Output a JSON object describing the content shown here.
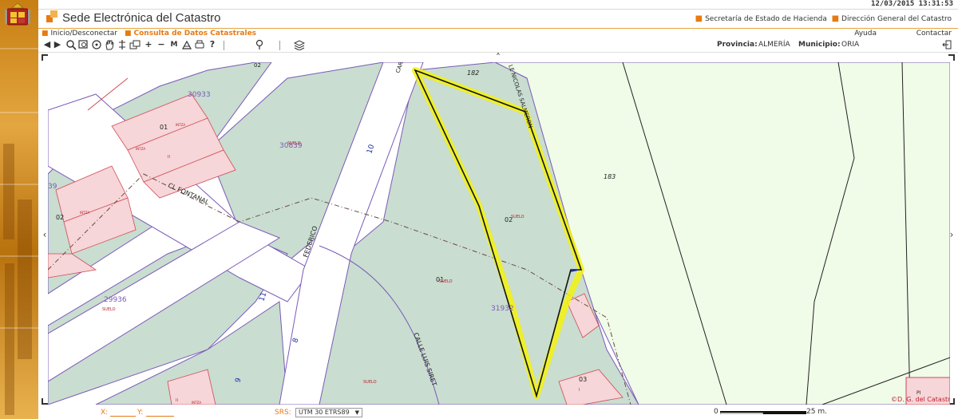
{
  "datetime": "12/03/2015 13:31:53",
  "site_title": "Sede Electrónica del Catastro",
  "header_links": [
    "Secretaría de Estado de Hacienda",
    "Dirección General del Catastro"
  ],
  "nav": {
    "login": "Inicio/Desconectar",
    "current": "Consulta de Datos Catastrales",
    "help": "Ayuda",
    "contact": "Contactar"
  },
  "toolbar_icons": [
    "back-arrow-icon",
    "forward-arrow-icon",
    "zoom-icon",
    "zoom-window-icon",
    "pan-hand-icon",
    "zoom-level-icon",
    "layers-icon",
    "zoom-in-icon",
    "zoom-out-icon",
    "measure-icon",
    "print-icon",
    "print-preview-icon",
    "help-icon",
    "locate-icon",
    "layers-stack-icon"
  ],
  "toolbar_glyphs": {
    "back": "◀",
    "forward": "▶",
    "zoom_in": "+",
    "zoom_out": "−",
    "measure": "M",
    "help": "?"
  },
  "location": {
    "province_label": "Provincia:",
    "province": "ALMERÍA",
    "municipality_label": "Municipio:",
    "municipality": "ORIA"
  },
  "map": {
    "parcel_labels": [
      "182",
      "183",
      "02",
      "01",
      "03",
      "30933",
      "30839",
      "29936",
      "31932",
      "02",
      "01",
      "PI",
      "39"
    ],
    "street_labels": [
      "CL FONTANAL",
      "FEDERICO",
      "CALLE LUIS SIRET",
      "LE NICOLAS SALMERON",
      "CAR"
    ],
    "numbers": [
      "02",
      "10",
      "11",
      "8",
      "9"
    ],
    "land_use": "SUELO",
    "roof_tag": "INTZA",
    "floors_tag": "II",
    "floors_tag_single": "I",
    "copyright": "©D. G. del Catastro",
    "colors": {
      "green_parcel": "#c9ddd0",
      "street": "#ffffff",
      "parcel_border": "#7a5ab8",
      "building": "#f6d6d8",
      "building_border": "#d04a58",
      "highlight": "#f4f20e",
      "light_green": "#f0fbe8"
    }
  },
  "footer": {
    "x_label": "X:",
    "y_label": "Y:",
    "srs_label": "SRS:",
    "srs_value": "UTM 30 ETRS89",
    "scale_zero": "0",
    "scale_label": "25 m."
  }
}
